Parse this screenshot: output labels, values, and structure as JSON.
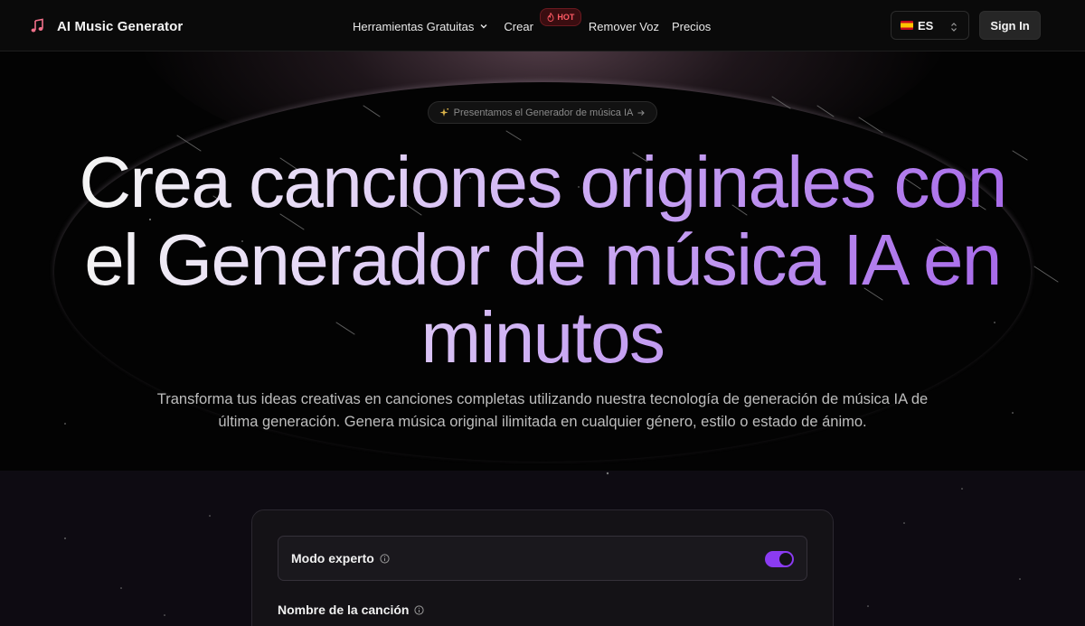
{
  "nav": {
    "brand": "AI Music Generator",
    "brand_icon": "music-note-icon",
    "links": {
      "free_tools": "Herramientas Gratuitas",
      "create": "Crear",
      "hot_badge": "HOT",
      "remove_voice": "Remover Voz",
      "prices": "Precios"
    },
    "language": {
      "code": "ES",
      "flag": "spain-flag-icon"
    },
    "sign_in": "Sign In"
  },
  "hero": {
    "announcement": "Presentamos el Generador de música IA",
    "headline": "Crea canciones originales con el Generador de música IA en minutos",
    "subtitle": "Transforma tus ideas creativas en canciones completas utilizando nuestra tecnología de generación de música IA de última generación. Genera música original ilimitada en cualquier género, estilo o estado de ánimo."
  },
  "form": {
    "expert_mode_label": "Modo experto",
    "expert_mode_on": true,
    "song_name_label": "Nombre de la canción"
  },
  "colors": {
    "accent": "#8b3bf2",
    "hot_badge": "#ff5a64",
    "headline_start": "#f4f4f4",
    "headline_end": "#a86bea"
  }
}
